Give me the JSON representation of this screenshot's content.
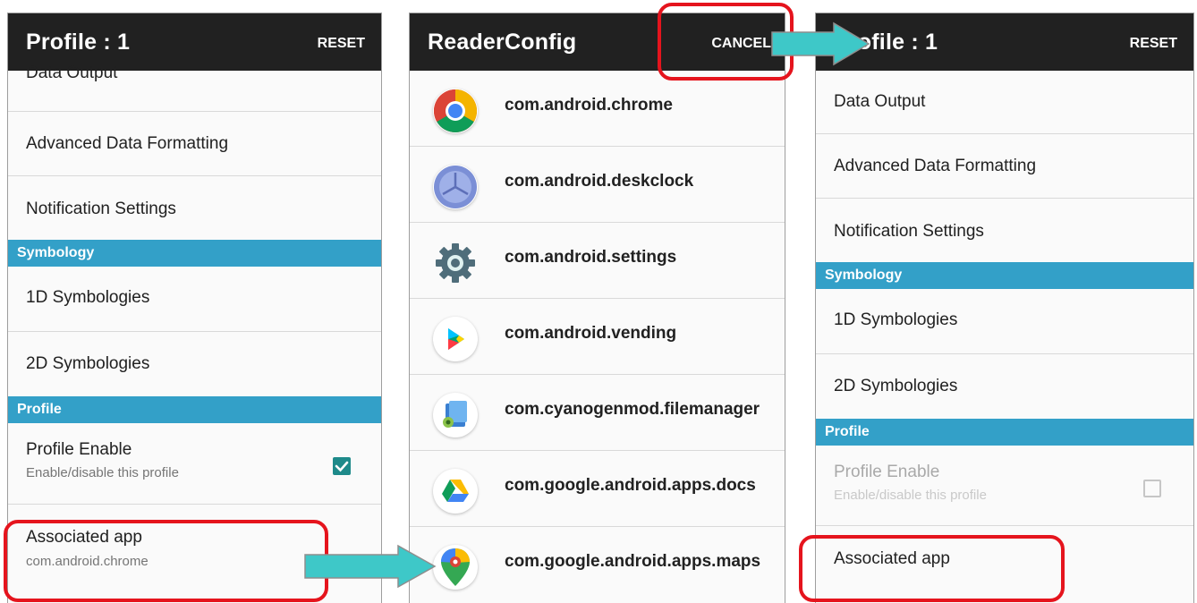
{
  "screen1": {
    "title": "Profile : 1",
    "action": "RESET",
    "items": {
      "data_output": "Data Output",
      "advanced": "Advanced Data Formatting",
      "notification": "Notification Settings",
      "symbology_header": "Symbology",
      "sym1d": "1D Symbologies",
      "sym2d": "2D Symbologies",
      "profile_header": "Profile",
      "profile_enable": "Profile Enable",
      "profile_enable_sub": "Enable/disable this profile",
      "profile_enable_checked": true,
      "associated_app": "Associated app",
      "associated_app_sub": "com.android.chrome"
    }
  },
  "screen2": {
    "title": "ReaderConfig",
    "action": "CANCEL",
    "apps": [
      {
        "name": "com.android.chrome",
        "icon": "chrome-icon"
      },
      {
        "name": "com.android.deskclock",
        "icon": "deskclock-icon"
      },
      {
        "name": "com.android.settings",
        "icon": "settings-gear-icon"
      },
      {
        "name": "com.android.vending",
        "icon": "play-store-icon"
      },
      {
        "name": "com.cyanogenmod.filemanager",
        "icon": "file-manager-icon"
      },
      {
        "name": "com.google.android.apps.docs",
        "icon": "google-drive-icon"
      },
      {
        "name": "com.google.android.apps.maps",
        "icon": "google-maps-icon"
      }
    ]
  },
  "screen3": {
    "title": "Profile : 1",
    "action": "RESET",
    "items": {
      "data_output": "Data Output",
      "advanced": "Advanced Data Formatting",
      "notification": "Notification Settings",
      "symbology_header": "Symbology",
      "sym1d": "1D Symbologies",
      "sym2d": "2D Symbologies",
      "profile_header": "Profile",
      "profile_enable": "Profile Enable",
      "profile_enable_sub": "Enable/disable this profile",
      "profile_enable_checked": false,
      "associated_app": "Associated app"
    }
  },
  "colors": {
    "appbar": "#212121",
    "category": "#33a0c8",
    "checkbox_on": "#1e8a8a",
    "highlight": "#e5141d",
    "arrow": "#3ec8c8"
  }
}
